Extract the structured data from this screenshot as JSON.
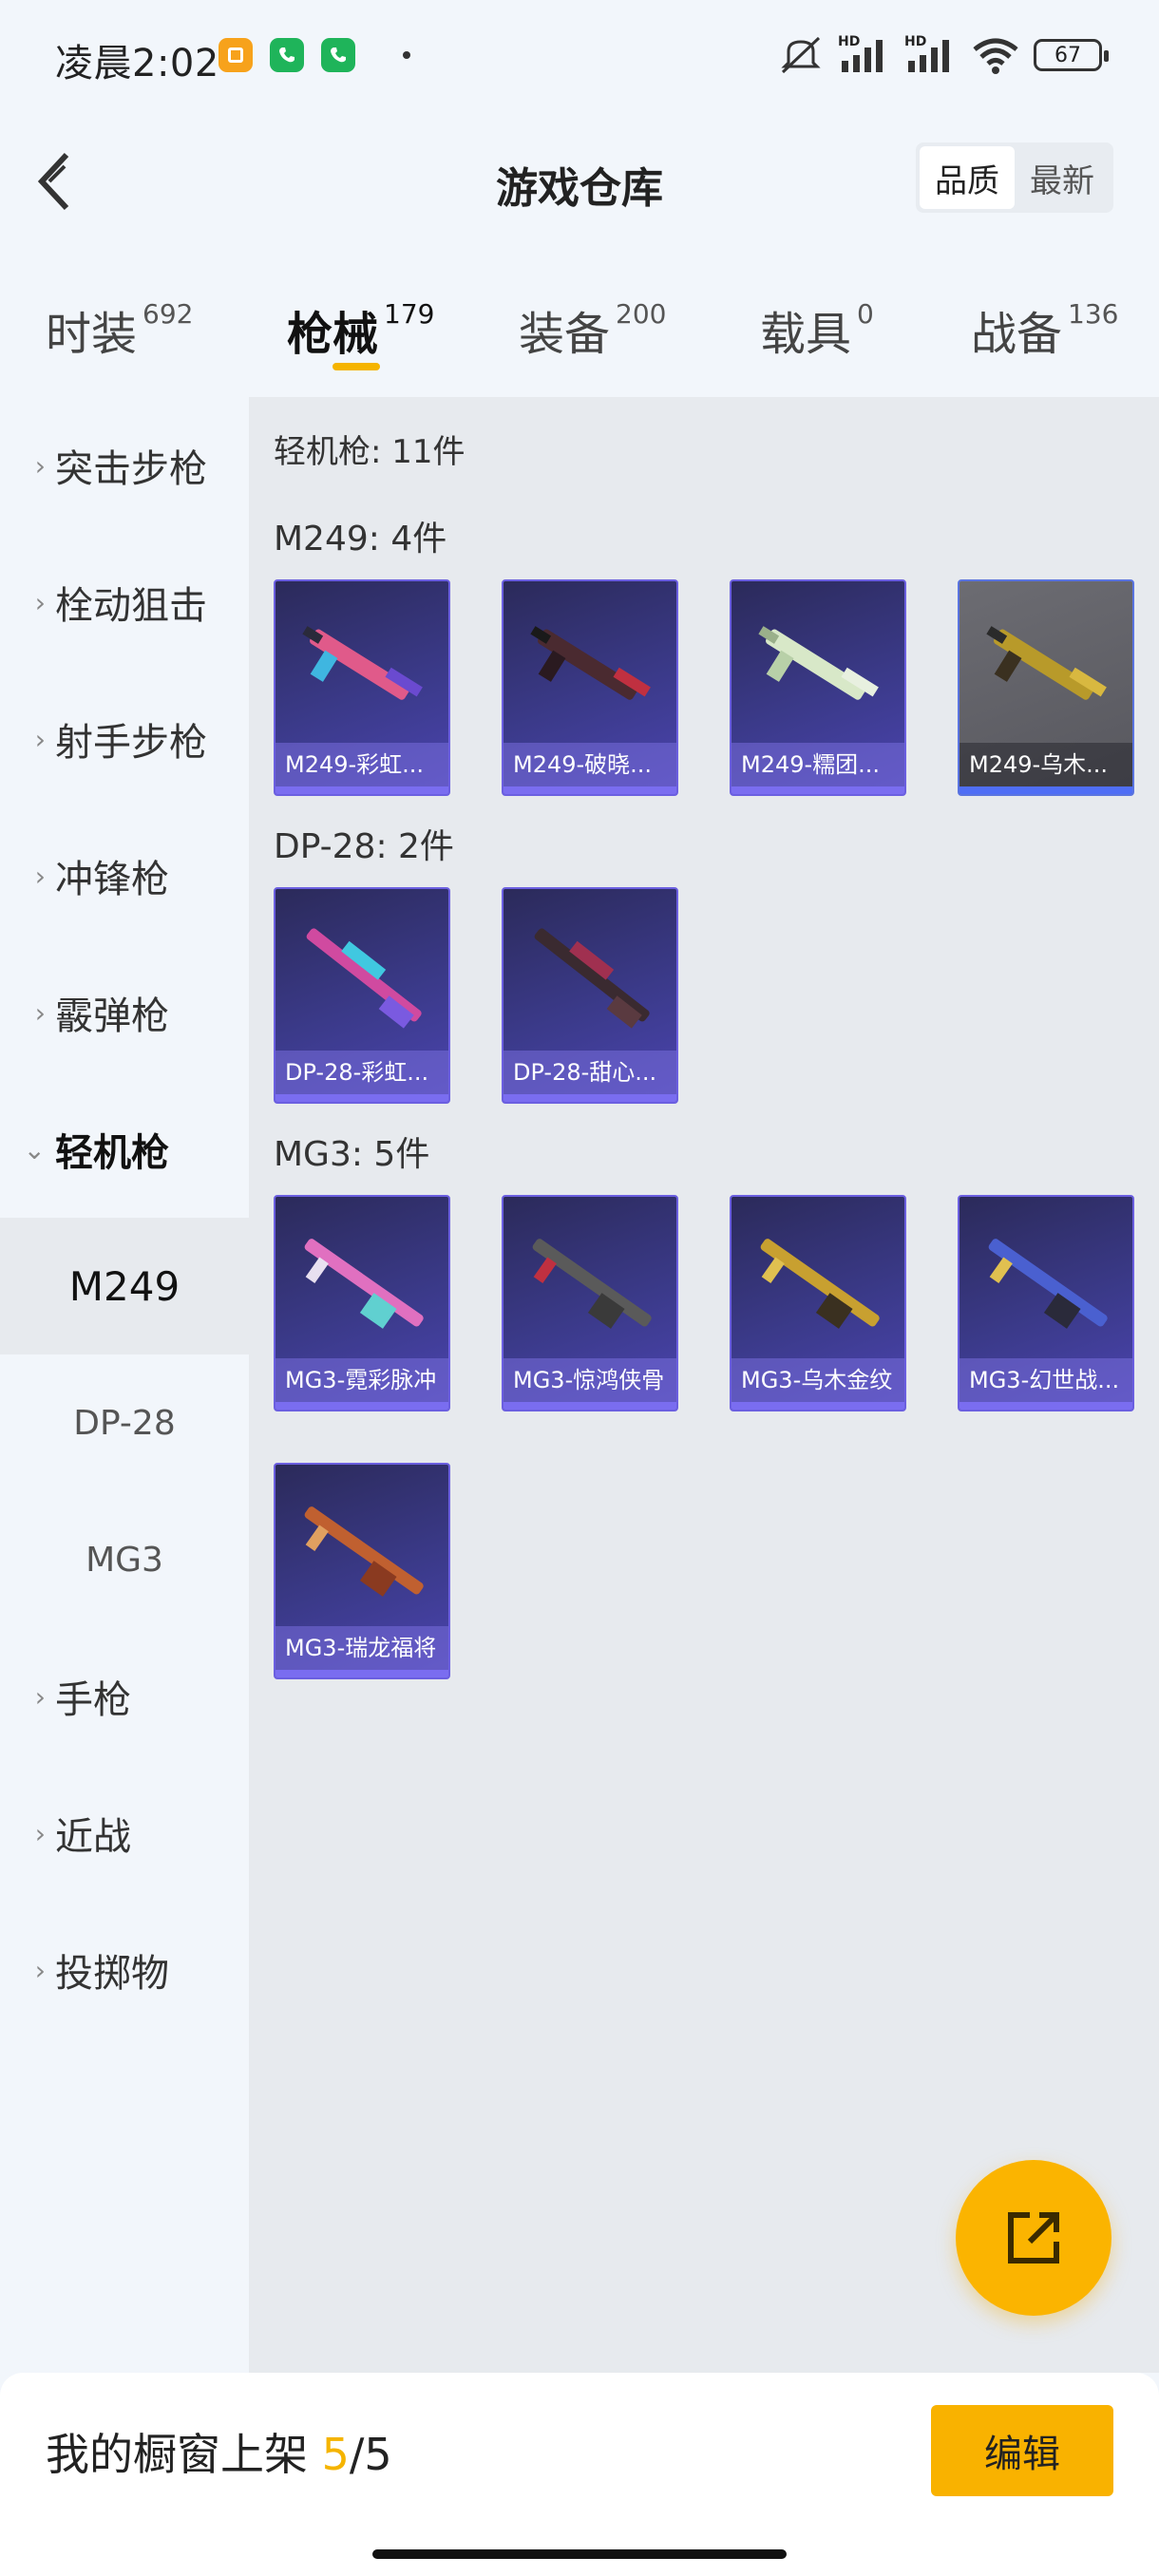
{
  "status_bar": {
    "time": "凌晨2:02",
    "battery": "67",
    "hd1": "HD",
    "hd2": "HD",
    "icons": [
      "gallery-app-icon",
      "phone-app-icon",
      "phone-app-icon",
      "mute-icon",
      "signal-icon",
      "signal-icon",
      "wifi-icon",
      "battery-icon"
    ],
    "colors": {
      "gallery": "#f7a21b",
      "phone": "#1fb45a"
    }
  },
  "header": {
    "title": "游戏仓库",
    "sort_options": [
      "品质",
      "最新"
    ],
    "active_sort": "品质"
  },
  "tabs": [
    {
      "label": "时装",
      "count": "692"
    },
    {
      "label": "枪械",
      "count": "179",
      "active": true
    },
    {
      "label": "装备",
      "count": "200"
    },
    {
      "label": "载具",
      "count": "0"
    },
    {
      "label": "战备",
      "count": "136"
    }
  ],
  "sidebar": {
    "items": [
      "突击步枪",
      "栓动狙击",
      "射手步枪",
      "冲锋枪",
      "霰弹枪",
      "轻机枪"
    ],
    "sub_items": [
      "M249",
      "DP-28",
      "MG3"
    ],
    "active_sub": "M249",
    "items_after": [
      "手枪",
      "近战",
      "投掷物"
    ]
  },
  "main": {
    "total": "轻机枪: 11件",
    "groups": [
      {
        "title": "M249: 4件",
        "items": [
          "M249-彩虹...",
          "M249-破晓...",
          "M249-糯团...",
          "M249-乌木..."
        ]
      },
      {
        "title": "DP-28: 2件",
        "items": [
          "DP-28-彩虹...",
          "DP-28-甜心..."
        ]
      },
      {
        "title": "MG3: 5件",
        "items": [
          "MG3-霓彩脉冲",
          "MG3-惊鸿侠骨",
          "MG3-乌木金纹",
          "MG3-幻世战...",
          "MG3-瑞龙福将"
        ]
      }
    ]
  },
  "bottom_bar": {
    "text": "我的橱窗上架",
    "current": "5",
    "sep_total": "/5",
    "edit_label": "编辑"
  },
  "colors": {
    "accent": "#f5b400",
    "card_bg": "#3b3a8a"
  }
}
